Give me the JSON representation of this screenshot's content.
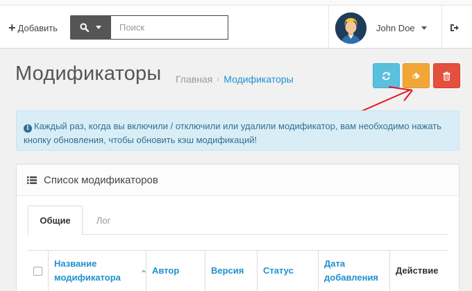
{
  "header": {
    "add_label": "Добавить",
    "search_placeholder": "Поиск",
    "username": "John Doe"
  },
  "page": {
    "title": "Модификаторы",
    "breadcrumb": {
      "home": "Главная",
      "separator": "›",
      "current": "Модификаторы"
    }
  },
  "toolbar": {
    "refresh_color": "#5bc0de",
    "clear_color": "#f3a638",
    "delete_color": "#e3503e"
  },
  "alert": {
    "text": "Каждый раз, когда вы включили / отключили или удалили модификатор, вам необходимо нажать кнопку обновления, чтобы обновить кэш модификаций!"
  },
  "panel": {
    "title": "Список модификаторов",
    "tabs": [
      {
        "label": "Общие",
        "active": true
      },
      {
        "label": "Лог",
        "active": false
      }
    ],
    "table": {
      "columns": [
        {
          "label": "Название модификатора",
          "sortable": true,
          "sorted": "asc"
        },
        {
          "label": "Автор",
          "sortable": true
        },
        {
          "label": "Версия",
          "sortable": true
        },
        {
          "label": "Статус",
          "sortable": true
        },
        {
          "label": "Дата добавления",
          "sortable": true
        },
        {
          "label": "Действие",
          "sortable": false
        }
      ]
    }
  },
  "colors": {
    "link": "#1e91cf",
    "annotation_arrow": "#e0141e"
  }
}
